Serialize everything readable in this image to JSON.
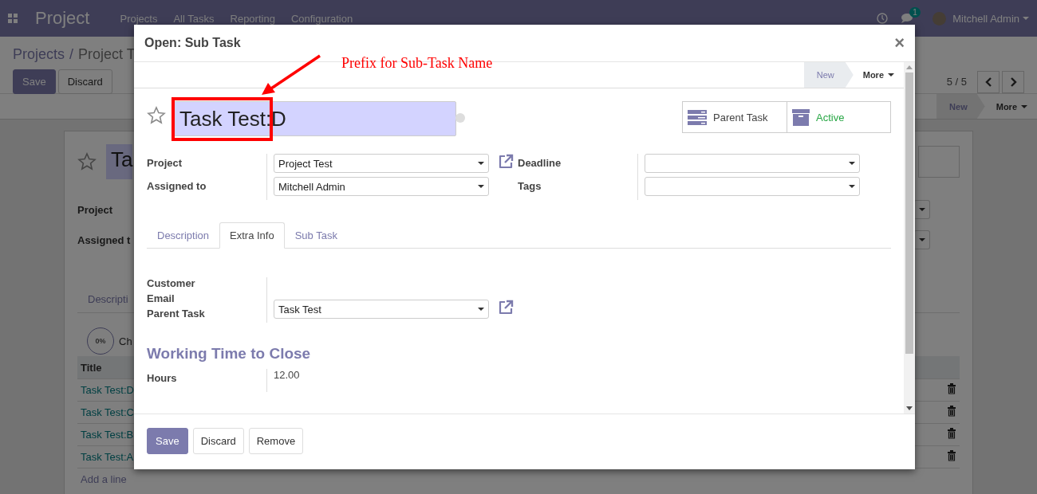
{
  "navbar": {
    "app": "Project",
    "menu": [
      "Projects",
      "All Tasks",
      "Reporting",
      "Configuration"
    ],
    "chat_count": "1",
    "user": "Mitchell Admin"
  },
  "control_panel": {
    "breadcrumbs": [
      "Projects",
      "/",
      "Project T"
    ],
    "buttons": [
      {
        "label": "Save",
        "kind": "primary"
      },
      {
        "label": "Discard",
        "kind": "secondary"
      }
    ],
    "pager": "5 / 5"
  },
  "statusbar": {
    "stages": [
      {
        "label": "New",
        "selected": true
      }
    ],
    "more": "More"
  },
  "sheet": {
    "title": "Ta",
    "starred": false,
    "fields": [
      "Project",
      "Assigned t"
    ],
    "tabs": [
      {
        "label": "Descripti",
        "selected": false
      }
    ],
    "progress": "0%",
    "checklist_label": "Ch",
    "table": {
      "columns": [
        "Title"
      ],
      "rows": [
        "Task Test:D",
        "Task Test:C",
        "Task Test:B",
        "Task Test:A"
      ],
      "add_line": "Add a line"
    }
  },
  "dialog": {
    "title": "Open: Sub Task",
    "close": "×",
    "statusbar": {
      "stages": [
        {
          "label": "New",
          "selected": true
        }
      ],
      "more": "More"
    },
    "name": "Task Test:D",
    "starred": false,
    "smart_buttons": [
      {
        "kind": "parent",
        "label": "Parent Task"
      },
      {
        "kind": "active",
        "label": "Active"
      }
    ],
    "fields_left": [
      {
        "label": "Project",
        "value": "Project Test",
        "external_link": true
      },
      {
        "label": "Assigned to",
        "value": "Mitchell Admin",
        "external_link": false
      }
    ],
    "fields_right": [
      {
        "label": "Deadline"
      },
      {
        "label": "Tags"
      }
    ],
    "tabs": [
      {
        "label": "Description",
        "selected": false
      },
      {
        "label": "Extra Info",
        "selected": true
      },
      {
        "label": "Sub Task",
        "selected": false
      }
    ],
    "extra_fields": [
      {
        "label": "Customer"
      },
      {
        "label": "Email"
      },
      {
        "label": "Parent Task",
        "value": "Task Test",
        "external_link": true
      }
    ],
    "section_title": "Working Time to Close",
    "time_fields": [
      {
        "label": "Hours",
        "value": "12.00"
      }
    ],
    "buttons": [
      {
        "label": "Save",
        "kind": "primary"
      },
      {
        "label": "Discard",
        "kind": "secondary"
      },
      {
        "label": "Remove",
        "kind": "secondary"
      }
    ],
    "annotation": {
      "text": "Prefix for Sub-Task Name"
    }
  }
}
